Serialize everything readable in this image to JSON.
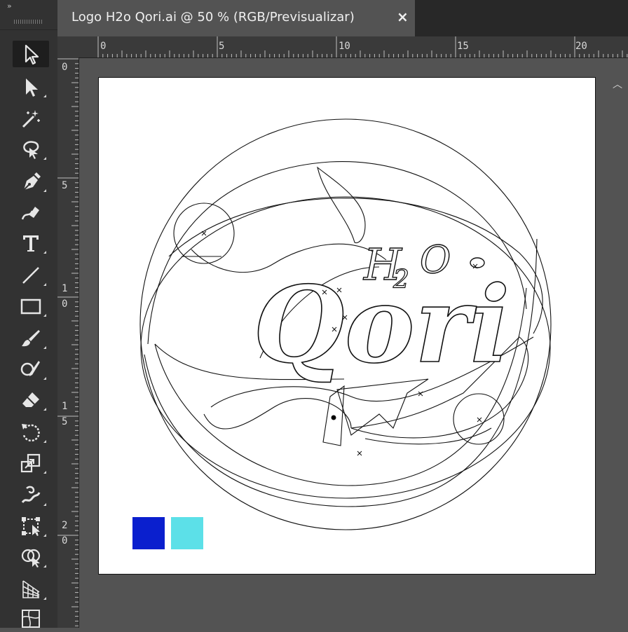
{
  "document": {
    "tab_title": "Logo H2o Qori.ai @ 50 % (RGB/Previsualizar)",
    "close_glyph": "×"
  },
  "toolbar": {
    "collapse_glyph": "»",
    "tools": [
      {
        "name": "selection-tool",
        "icon": "arrow-icon"
      },
      {
        "name": "direct-selection-tool",
        "icon": "filled-arrow-icon"
      },
      {
        "name": "magic-wand-tool",
        "icon": "magic-wand-icon"
      },
      {
        "name": "lasso-tool",
        "icon": "lasso-icon"
      },
      {
        "name": "pen-tool",
        "icon": "pen-icon"
      },
      {
        "name": "curvature-tool",
        "icon": "curvature-icon"
      },
      {
        "name": "type-tool",
        "icon": "type-icon"
      },
      {
        "name": "line-tool",
        "icon": "line-icon"
      },
      {
        "name": "rectangle-tool",
        "icon": "rectangle-icon"
      },
      {
        "name": "paintbrush-tool",
        "icon": "paintbrush-icon"
      },
      {
        "name": "shaper-tool",
        "icon": "shaper-icon"
      },
      {
        "name": "eraser-tool",
        "icon": "eraser-icon"
      },
      {
        "name": "rotate-tool",
        "icon": "rotate-icon"
      },
      {
        "name": "scale-tool",
        "icon": "scale-icon"
      },
      {
        "name": "warp-tool",
        "icon": "warp-icon"
      },
      {
        "name": "free-transform-tool",
        "icon": "free-transform-icon"
      },
      {
        "name": "shape-builder-tool",
        "icon": "shape-builder-icon"
      },
      {
        "name": "perspective-grid-tool",
        "icon": "perspective-grid-icon"
      },
      {
        "name": "mesh-tool",
        "icon": "mesh-icon"
      }
    ]
  },
  "rulers": {
    "horizontal": [
      "0",
      "5",
      "10",
      "15",
      "20"
    ],
    "vertical": [
      {
        "line1": "0",
        "line2": ""
      },
      {
        "line1": "5",
        "line2": ""
      },
      {
        "line1": "1",
        "line2": "0"
      },
      {
        "line1": "1",
        "line2": "5"
      },
      {
        "line1": "2",
        "line2": "0"
      }
    ]
  },
  "swatches": {
    "colors": [
      "#0a1fce",
      "#5ce0e8"
    ]
  },
  "artwork": {
    "brand": "Qori",
    "subscript_text": "H",
    "subscript_digit": "2",
    "subscript_o": "O"
  },
  "colors": {
    "app_bg": "#535353",
    "panel": "#323232",
    "artboard": "#ffffff"
  }
}
